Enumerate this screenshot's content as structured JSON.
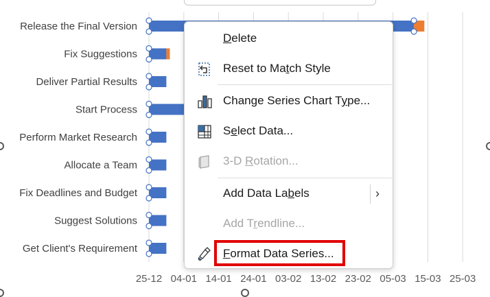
{
  "chart_data": {
    "type": "bar",
    "orientation": "horizontal-stacked",
    "categories": [
      "Release the Final Version",
      "Fix Suggestions",
      "Deliver Partial Results",
      "Start Process",
      "Perform Market Research",
      "Allocate a Team",
      "Fix Deadlines and Budget",
      "Suggest Solutions",
      "Get Client's Requirement"
    ],
    "x_ticks": [
      "25-12",
      "04-01",
      "14-01",
      "24-01",
      "03-02",
      "13-02",
      "23-02",
      "05-03",
      "15-03",
      "25-03"
    ],
    "series": [
      {
        "color": "#4472c4",
        "values": [
          "2024-03-10",
          "2023-12-30",
          "2023-12-30",
          "2024-01-18",
          "2023-12-30",
          "2023-12-30",
          "2023-12-30",
          "2023-12-30",
          "2023-12-30"
        ]
      },
      {
        "color": "#ed7d31",
        "values": [
          3,
          1,
          0,
          6,
          0,
          0,
          0,
          0,
          0
        ]
      }
    ],
    "grid": true
  },
  "context_menu": {
    "items": [
      {
        "label_pre": "",
        "label_u": "D",
        "label_post": "elete",
        "icon": "none",
        "disabled": false
      },
      {
        "label_pre": "Reset to Ma",
        "label_u": "t",
        "label_post": "ch Style",
        "icon": "reset-style-icon",
        "disabled": false
      },
      {
        "label_pre": "Change Series Chart T",
        "label_u": "y",
        "label_post": "pe...",
        "icon": "chart-type-icon",
        "disabled": false
      },
      {
        "label_pre": "S",
        "label_u": "e",
        "label_post": "lect Data...",
        "icon": "select-data-icon",
        "disabled": false
      },
      {
        "label_pre": "3-D ",
        "label_u": "R",
        "label_post": "otation...",
        "icon": "rotation-3d-icon",
        "disabled": true
      },
      {
        "label_pre": "Add Data La",
        "label_u": "b",
        "label_post": "els",
        "icon": "none",
        "disabled": false
      },
      {
        "label_pre": "Add T",
        "label_u": "r",
        "label_post": "endline...",
        "icon": "none",
        "disabled": true
      },
      {
        "label_pre": "",
        "label_u": "F",
        "label_post": "ormat Data Series...",
        "icon": "format-series-icon",
        "disabled": false
      }
    ],
    "submenu_arrow": "›",
    "highlight_color": "#e00000"
  }
}
